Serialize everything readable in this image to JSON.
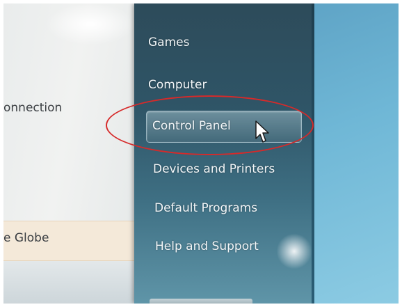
{
  "left_window": {
    "connection_text": "onnection",
    "globe_text": "e Globe"
  },
  "start_menu": {
    "items": [
      {
        "label": "Games"
      },
      {
        "label": "Computer"
      },
      {
        "label": "Control Panel"
      },
      {
        "label": "Devices and Printers"
      },
      {
        "label": "Default Programs"
      },
      {
        "label": "Help and Support"
      }
    ],
    "highlighted_item": "Control Panel"
  },
  "annotation": {
    "color": "#d62a2a",
    "shape": "ellipse",
    "target": "Control Panel"
  },
  "cursor": {
    "icon": "arrow-pointer-icon"
  }
}
